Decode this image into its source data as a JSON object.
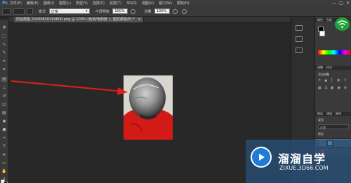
{
  "app": {
    "logo": "Ps"
  },
  "menu": [
    "文件(F)",
    "编辑(E)",
    "图像(I)",
    "图层(L)",
    "类型(Y)",
    "选择(S)",
    "滤镜(T)",
    "3D(D)",
    "视图(V)",
    "窗口(W)",
    "帮助(H)"
  ],
  "window_controls": {
    "minimize": "—",
    "maximize": "□",
    "close": "✕"
  },
  "options": {
    "mode_label": "模式:",
    "mode_value": "正常",
    "opacity_label": "不透明度:",
    "opacity_value": "100%",
    "flow_label": "流量:",
    "flow_value": "100%"
  },
  "document": {
    "tab_title": "原始截图 20200828194600.png @ 100% (色相/饱和度 1, 图层蒙版/8) *",
    "close": "×"
  },
  "panels": {
    "color_tab": "颜色",
    "swatches_tab": "色板",
    "adjustments_tab": "调整",
    "styles_tab": "样式",
    "adjust_add": "添加调整",
    "layers_tab": "图层",
    "channels_tab": "通道",
    "paths_tab": "路径",
    "kind_label": "类型",
    "blend_mode": "正常",
    "lock_label": "锁定:"
  },
  "watermark": {
    "title": "溜溜自学",
    "url": "ZIXUE.3D66.COM"
  },
  "colors": {
    "arrow": "#e0201a",
    "accent": "#1e7bd8",
    "badge": "#1fa23a",
    "shirt": "#d21b16"
  },
  "icons": {
    "tool_brush": "brush-icon",
    "tool_move": "move-icon",
    "arrow": "red-arrow-annotation"
  }
}
